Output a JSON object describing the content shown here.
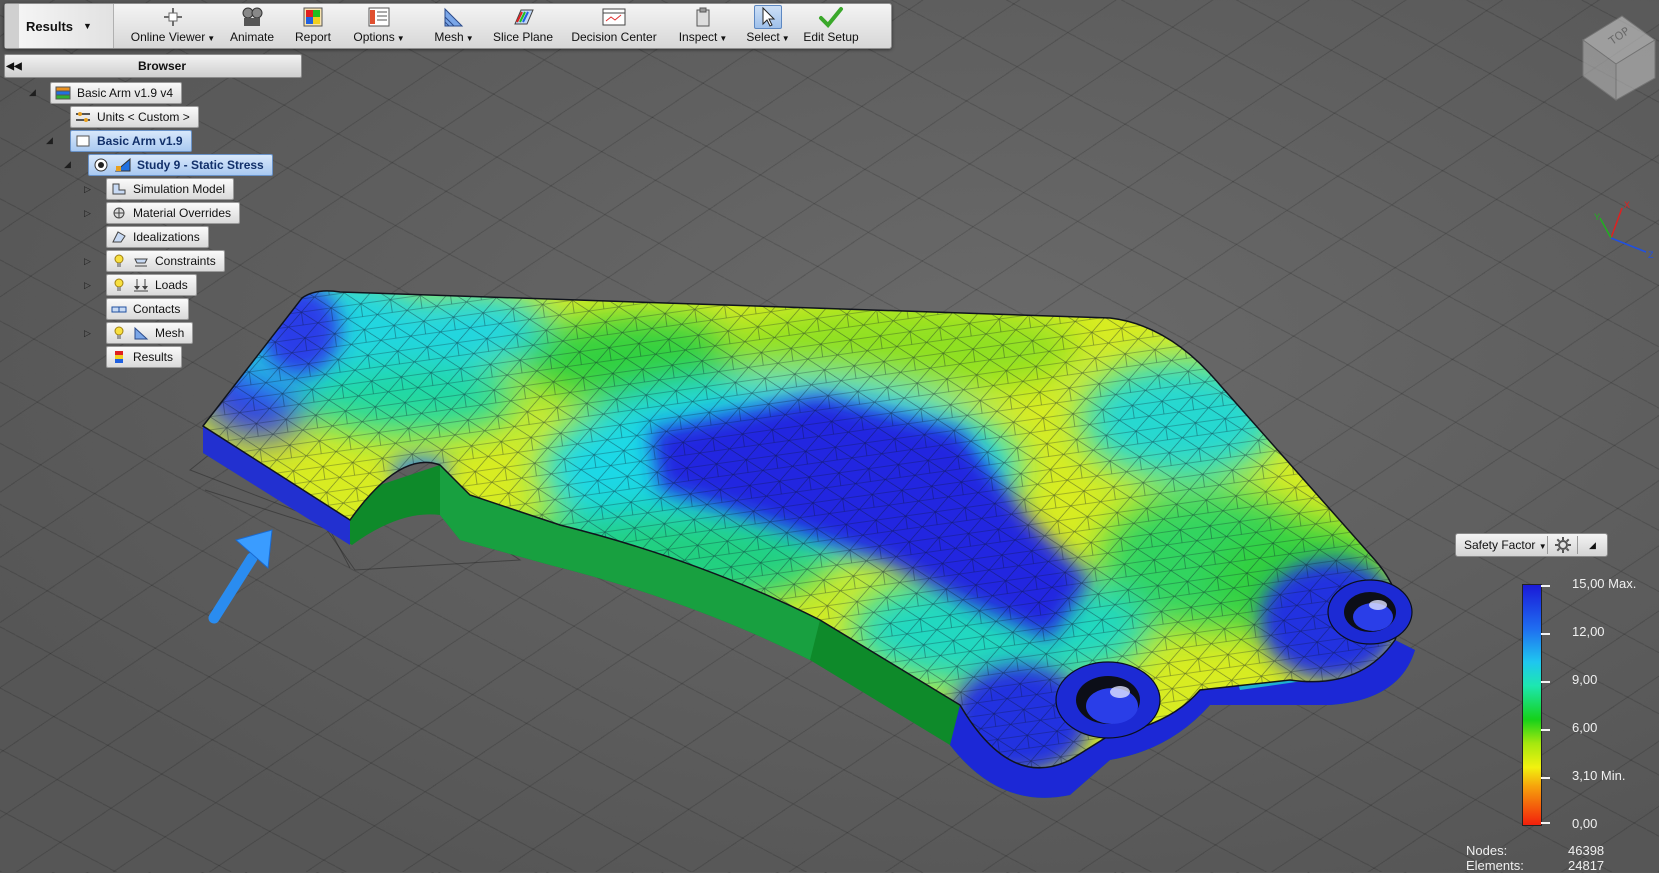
{
  "ribbon": {
    "results_tab": "Results",
    "tools": [
      {
        "label": "Online Viewer",
        "dropdown": true,
        "icon": "online-viewer-icon"
      },
      {
        "label": "Animate",
        "dropdown": false,
        "icon": "animate-icon"
      },
      {
        "label": "Report",
        "dropdown": false,
        "icon": "report-icon"
      },
      {
        "label": "Options",
        "dropdown": true,
        "icon": "options-icon"
      },
      {
        "label": "Mesh",
        "dropdown": true,
        "icon": "mesh-icon"
      },
      {
        "label": "Slice Plane",
        "dropdown": false,
        "icon": "slice-plane-icon"
      },
      {
        "label": "Decision Center",
        "dropdown": false,
        "icon": "decision-center-icon"
      },
      {
        "label": "Inspect",
        "dropdown": true,
        "icon": "inspect-icon"
      },
      {
        "label": "Select",
        "dropdown": true,
        "icon": "select-cursor-icon"
      },
      {
        "label": "Edit Setup",
        "dropdown": false,
        "icon": "checkmark-icon"
      }
    ]
  },
  "browser": {
    "title": "Browser",
    "nodes": [
      {
        "label": "Basic Arm v1.9 v4"
      },
      {
        "label": "Units < Custom >"
      },
      {
        "label": "Basic Arm v1.9"
      },
      {
        "label": "Study 9 - Static Stress"
      },
      {
        "label": "Simulation Model"
      },
      {
        "label": "Material Overrides"
      },
      {
        "label": "Idealizations"
      },
      {
        "label": "Constraints"
      },
      {
        "label": "Loads"
      },
      {
        "label": "Contacts"
      },
      {
        "label": "Mesh"
      },
      {
        "label": "Results"
      }
    ]
  },
  "viewcube": {
    "face": "TOP"
  },
  "triad": {
    "x": "X",
    "y": "Y",
    "z": "Z"
  },
  "legend": {
    "result_type": "Safety Factor",
    "labels": [
      "15,00 Max.",
      "12,00",
      "9,00",
      "6,00",
      "3,10 Min.",
      "0,00"
    ],
    "max_value": 15.0,
    "min_value": 3.1
  },
  "mesh_stats": {
    "nodes_label": "Nodes:",
    "nodes_value": "46398",
    "elements_label": "Elements:",
    "elements_value": "24817"
  },
  "colors": {
    "contour_blue": "#1f2fe0",
    "contour_cyan": "#1fe0e8",
    "contour_green": "#20d030",
    "contour_yellow": "#eaf020",
    "selection_blue": "#a9c9f1",
    "load_arrow": "#2a8cf0"
  }
}
